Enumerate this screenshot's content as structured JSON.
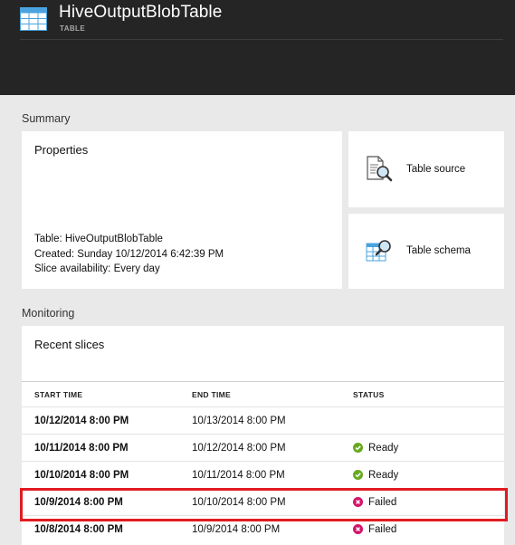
{
  "header": {
    "title": "HiveOutputBlobTable",
    "subtitle": "TABLE",
    "icon": "table-icon"
  },
  "summary": {
    "label": "Summary",
    "properties": {
      "title": "Properties",
      "lines": [
        "Table: HiveOutputBlobTable",
        "Created: Sunday 10/12/2014 6:42:39 PM",
        "Slice availability: Every day"
      ]
    },
    "table_source": {
      "label": "Table source",
      "icon": "document-search-icon"
    },
    "table_schema": {
      "label": "Table schema",
      "icon": "table-search-icon"
    }
  },
  "monitoring": {
    "label": "Monitoring",
    "recent_slices": {
      "title": "Recent slices",
      "columns": [
        "START TIME",
        "END TIME",
        "STATUS"
      ],
      "rows": [
        {
          "start": "10/12/2014 8:00 PM",
          "end": "10/13/2014 8:00 PM",
          "status": "",
          "status_kind": "none"
        },
        {
          "start": "10/11/2014 8:00 PM",
          "end": "10/12/2014 8:00 PM",
          "status": "Ready",
          "status_kind": "ready"
        },
        {
          "start": "10/10/2014 8:00 PM",
          "end": "10/11/2014 8:00 PM",
          "status": "Ready",
          "status_kind": "ready"
        },
        {
          "start": "10/9/2014 8:00 PM",
          "end": "10/10/2014 8:00 PM",
          "status": "Failed",
          "status_kind": "failed"
        },
        {
          "start": "10/8/2014 8:00 PM",
          "end": "10/9/2014 8:00 PM",
          "status": "Failed",
          "status_kind": "failed"
        }
      ]
    }
  },
  "colors": {
    "header_bg": "#252525",
    "ready": "#67a920",
    "failed": "#d4146b",
    "highlight": "#e11b22"
  }
}
